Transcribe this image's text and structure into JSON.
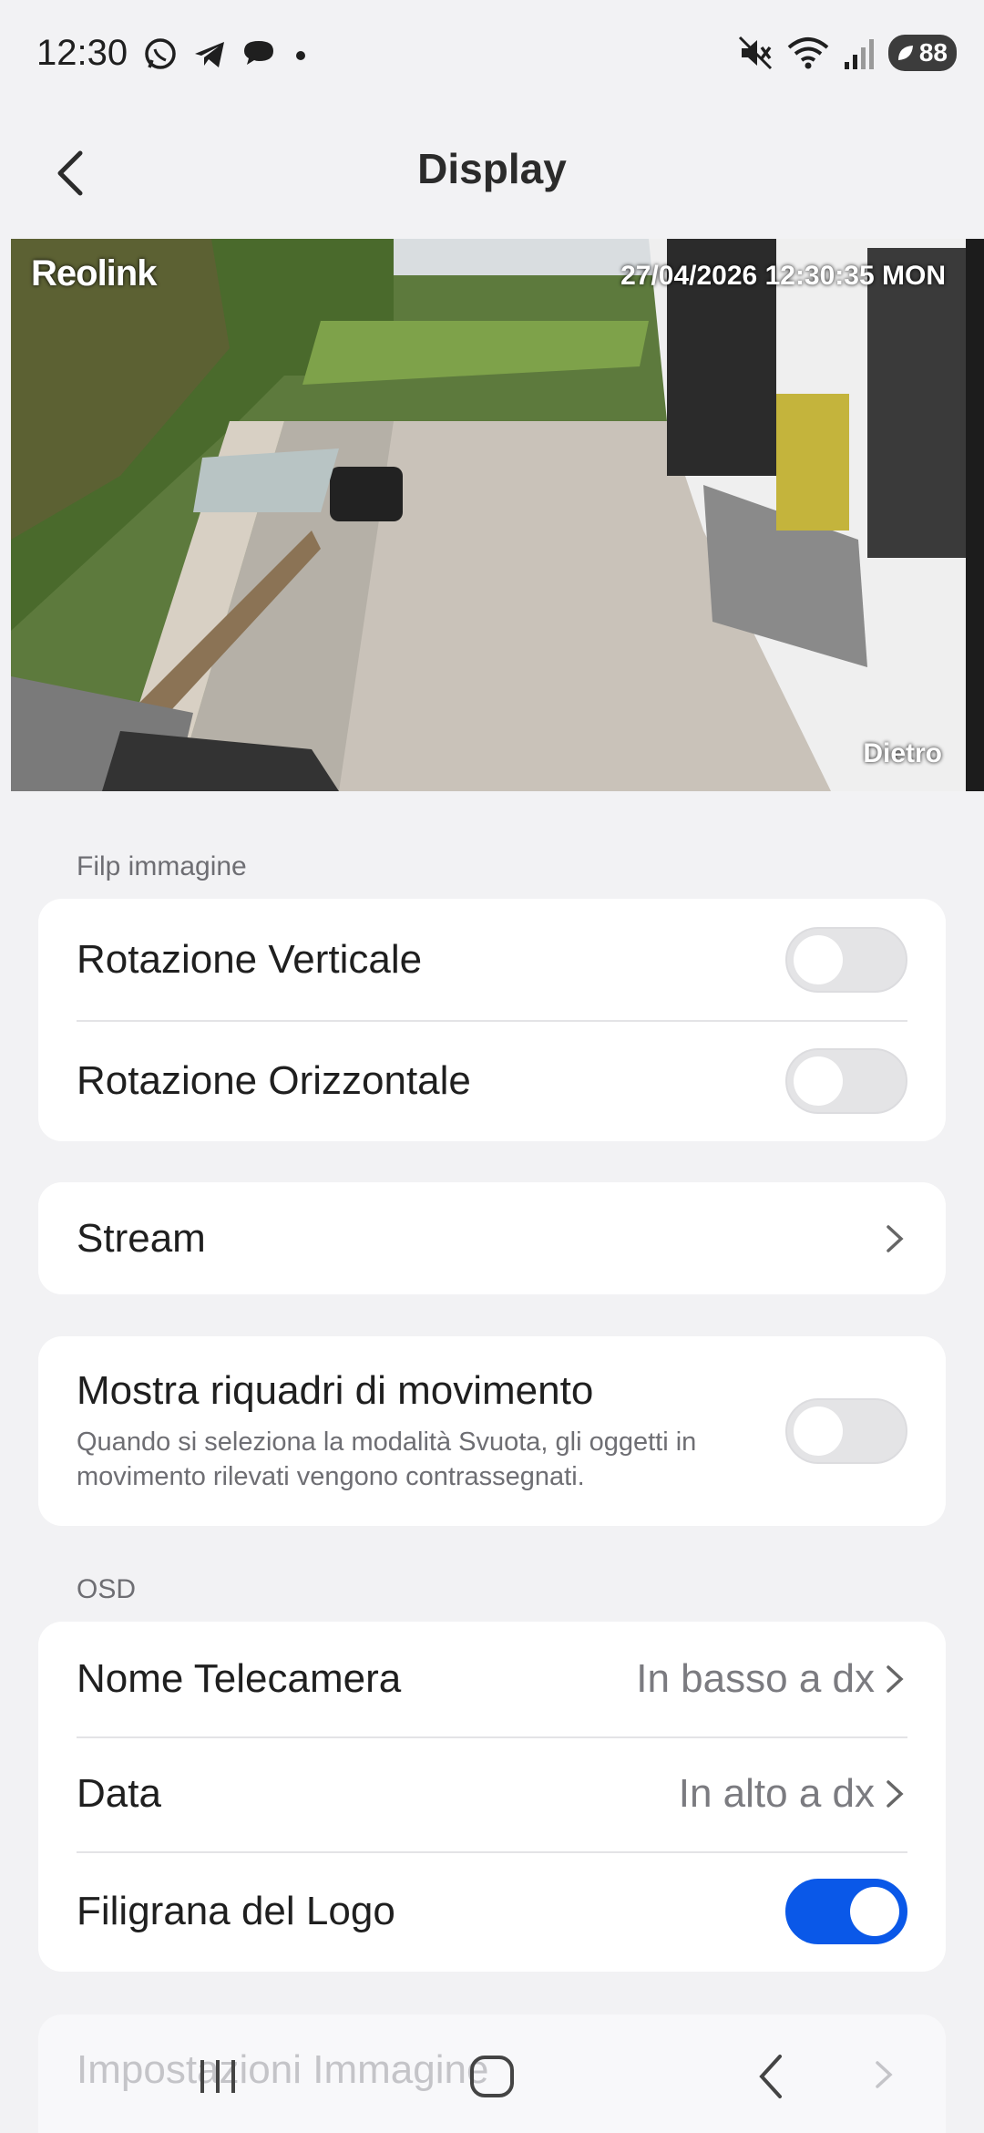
{
  "status_bar": {
    "time": "12:30",
    "left_icons": [
      "whatsapp-icon",
      "telegram-icon",
      "chat-bubble-icon",
      "dot-icon"
    ],
    "right_icons": [
      "mute-icon",
      "wifi-icon",
      "signal-icon"
    ],
    "battery": "88"
  },
  "header": {
    "title": "Display"
  },
  "camera": {
    "logo": "Reolink",
    "datetime": "27/04/2026 12:30:35 MON",
    "camera_name": "Dietro"
  },
  "flip_section": {
    "label": "Filp immagine",
    "items": [
      {
        "label": "Rotazione Verticale",
        "enabled": false
      },
      {
        "label": "Rotazione Orizzontale",
        "enabled": false
      }
    ]
  },
  "stream": {
    "label": "Stream"
  },
  "motion": {
    "title": "Mostra riquadri di movimento",
    "description": "Quando si seleziona la modalità Svuota, gli oggetti in movimento rilevati vengono contrassegnati.",
    "enabled": false
  },
  "osd_section": {
    "label": "OSD",
    "camera_name_label": "Nome Telecamera",
    "camera_name_value": "In basso a dx",
    "date_label": "Data",
    "date_value": "In alto a dx",
    "logo_label": "Filigrana del Logo",
    "logo_enabled": true
  },
  "image_settings": {
    "label": "Impostazioni Immagine"
  },
  "colors": {
    "accent": "#0a58e8",
    "background": "#f2f2f4",
    "card": "#ffffff"
  }
}
